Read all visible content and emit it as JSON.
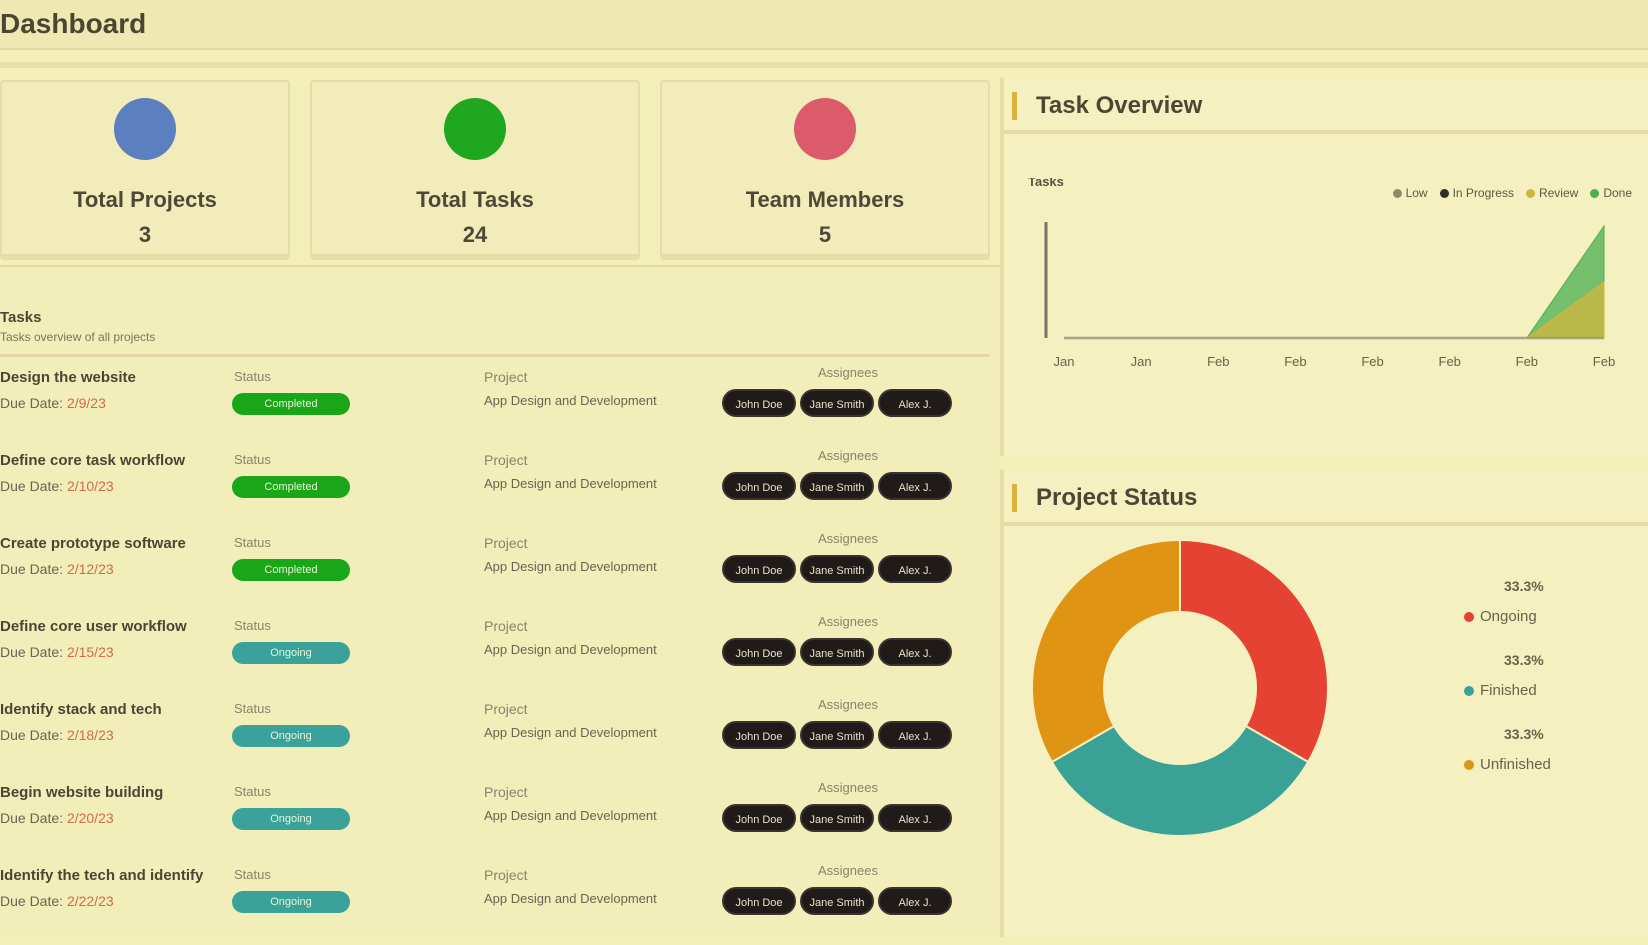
{
  "page": {
    "title": "Dashboard"
  },
  "stats": [
    {
      "label": "Total Projects",
      "value": "3",
      "color": "#5c7fbf",
      "icon": "folder-icon"
    },
    {
      "label": "Total Tasks",
      "value": "24",
      "color": "#1fa81f",
      "icon": "tasks-icon"
    },
    {
      "label": "Team Members",
      "value": "5",
      "color": "#dc5b6a",
      "icon": "users-icon"
    }
  ],
  "tasks": {
    "title": "Tasks",
    "subtitle": "Tasks overview of all projects",
    "labels": {
      "status": "Status",
      "project": "Project",
      "assignees": "Assignees"
    },
    "rows": [
      {
        "name": "Design the website",
        "due_prefix": "Due Date:",
        "due_date": "2/9/23",
        "status": "Completed",
        "status_color": "#19a619",
        "project": "App Design and Development",
        "assignees": [
          "John Doe",
          "Jane Smith",
          "Alex J."
        ]
      },
      {
        "name": "Define core task workflow",
        "due_prefix": "Due Date:",
        "due_date": "2/10/23",
        "status": "Completed",
        "status_color": "#19a619",
        "project": "App Design and Development",
        "assignees": [
          "John Doe",
          "Jane Smith",
          "Alex J."
        ]
      },
      {
        "name": "Create prototype software",
        "due_prefix": "Due Date:",
        "due_date": "2/12/23",
        "status": "Completed",
        "status_color": "#19a619",
        "project": "App Design and Development",
        "assignees": [
          "John Doe",
          "Jane Smith",
          "Alex J."
        ]
      },
      {
        "name": "Define core user workflow",
        "due_prefix": "Due Date:",
        "due_date": "2/15/23",
        "status": "Ongoing",
        "status_color": "#3aa29a",
        "project": "App Design and Development",
        "assignees": [
          "John Doe",
          "Jane Smith",
          "Alex J."
        ]
      },
      {
        "name": "Identify stack and tech",
        "due_prefix": "Due Date:",
        "due_date": "2/18/23",
        "status": "Ongoing",
        "status_color": "#3aa29a",
        "project": "App Design and Development",
        "assignees": [
          "John Doe",
          "Jane Smith",
          "Alex J."
        ]
      },
      {
        "name": "Begin website building",
        "due_prefix": "Due Date:",
        "due_date": "2/20/23",
        "status": "Ongoing",
        "status_color": "#3aa29a",
        "project": "App Design and Development",
        "assignees": [
          "John Doe",
          "Jane Smith",
          "Alex J."
        ]
      },
      {
        "name": "Identify the tech and identify",
        "due_prefix": "Due Date:",
        "due_date": "2/22/23",
        "status": "Ongoing",
        "status_color": "#3aa29a",
        "project": "App Design and Development",
        "assignees": [
          "John Doe",
          "Jane Smith",
          "Alex J."
        ]
      }
    ]
  },
  "overview": {
    "title": "Task Overview",
    "chart_data": {
      "type": "area",
      "title": "",
      "ylabel": "Tasks",
      "xlabel": "",
      "categories": [
        "Jan",
        "Jan",
        "Feb",
        "Feb",
        "Feb",
        "Feb",
        "Feb",
        "Feb"
      ],
      "legend_position": "top-right",
      "series": [
        {
          "name": "Low",
          "color": "#8b8a6f",
          "values": [
            0,
            0,
            0,
            0,
            0,
            0,
            0,
            0
          ]
        },
        {
          "name": "In Progress",
          "color": "#2f2f2a",
          "values": [
            0,
            0,
            0,
            0,
            0,
            0,
            0,
            0
          ]
        },
        {
          "name": "Review",
          "color": "#d2b53c",
          "values": [
            0,
            0,
            0,
            0,
            0,
            0,
            0,
            2
          ]
        },
        {
          "name": "Done",
          "color": "#4caf50",
          "values": [
            0,
            0,
            0,
            0,
            0,
            0,
            0,
            4
          ]
        }
      ],
      "ylim": [
        0,
        5
      ]
    }
  },
  "project_status": {
    "title": "Project Status",
    "chart_data": {
      "type": "pie",
      "labels": [
        "Ongoing",
        "Finished",
        "Unfinished"
      ],
      "values": [
        33.3,
        33.3,
        33.3
      ],
      "percent_labels": [
        "33.3%",
        "33.3%",
        "33.3%"
      ],
      "colors": [
        "#e64233",
        "#3aa196",
        "#df9513"
      ]
    }
  }
}
